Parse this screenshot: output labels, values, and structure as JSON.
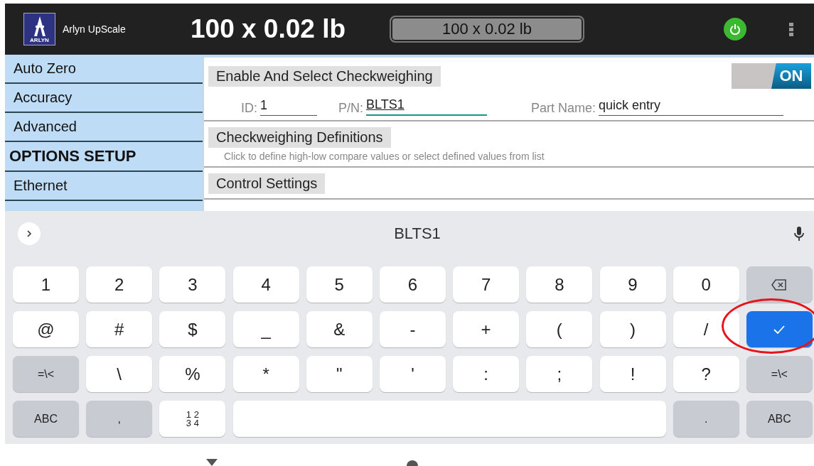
{
  "header": {
    "app_name": "Arlyn UpScale",
    "logo_text": "ARLYN",
    "reading": "100 x 0.02 lb",
    "display": "100 x 0.02 lb",
    "power_on": true
  },
  "sidebar": {
    "items": [
      {
        "kind": "item",
        "label": "Auto Zero"
      },
      {
        "kind": "item",
        "label": "Accuracy"
      },
      {
        "kind": "item",
        "label": "Advanced"
      },
      {
        "kind": "heading",
        "label": "OPTIONS SETUP"
      },
      {
        "kind": "item",
        "label": "Ethernet"
      }
    ]
  },
  "sections": [
    {
      "title": "Enable And Select Checkweighing",
      "toggle": {
        "on": true,
        "label": "ON"
      },
      "fields": [
        {
          "label": "ID:",
          "value": "1",
          "focused": false
        },
        {
          "label": "P/N:",
          "value": "BLTS1",
          "focused": true
        },
        {
          "label": "Part Name:",
          "value": "quick entry",
          "focused": false
        }
      ]
    },
    {
      "title": "Checkweighing Definitions",
      "hint": "Click to define high-low compare values or select defined values from list"
    },
    {
      "title": "Control Settings"
    }
  ],
  "keyboard": {
    "suggestion": "BLTS1",
    "rows": [
      [
        {
          "kind": "char",
          "label": "1"
        },
        {
          "kind": "char",
          "label": "2"
        },
        {
          "kind": "char",
          "label": "3"
        },
        {
          "kind": "char",
          "label": "4"
        },
        {
          "kind": "char",
          "label": "5"
        },
        {
          "kind": "char",
          "label": "6"
        },
        {
          "kind": "char",
          "label": "7"
        },
        {
          "kind": "char",
          "label": "8"
        },
        {
          "kind": "char",
          "label": "9"
        },
        {
          "kind": "char",
          "label": "0"
        },
        {
          "kind": "backspace"
        }
      ],
      [
        {
          "kind": "char",
          "label": "@"
        },
        {
          "kind": "char",
          "label": "#"
        },
        {
          "kind": "char",
          "label": "$"
        },
        {
          "kind": "char",
          "label": "_"
        },
        {
          "kind": "char",
          "label": "&"
        },
        {
          "kind": "char",
          "label": "-"
        },
        {
          "kind": "char",
          "label": "+"
        },
        {
          "kind": "char",
          "label": "("
        },
        {
          "kind": "char",
          "label": ")"
        },
        {
          "kind": "char",
          "label": "/"
        },
        {
          "kind": "enter",
          "highlighted": true
        }
      ],
      [
        {
          "kind": "function",
          "label": "=\\<"
        },
        {
          "kind": "char",
          "label": "\\"
        },
        {
          "kind": "char",
          "label": "%"
        },
        {
          "kind": "char",
          "label": "*"
        },
        {
          "kind": "char",
          "label": "\""
        },
        {
          "kind": "char",
          "label": "'"
        },
        {
          "kind": "char",
          "label": ":"
        },
        {
          "kind": "char",
          "label": ";"
        },
        {
          "kind": "char",
          "label": "!"
        },
        {
          "kind": "char",
          "label": "?"
        },
        {
          "kind": "function",
          "label": "=\\<"
        }
      ],
      [
        {
          "kind": "function",
          "label": "ABC"
        },
        {
          "kind": "function",
          "label": ","
        },
        {
          "kind": "fraction",
          "lines": [
            "1 2",
            "3 4"
          ]
        },
        {
          "kind": "space"
        },
        "",
        "",
        "",
        "",
        "",
        {
          "kind": "function",
          "label": "."
        },
        {
          "kind": "function",
          "label": "ABC"
        }
      ]
    ]
  }
}
